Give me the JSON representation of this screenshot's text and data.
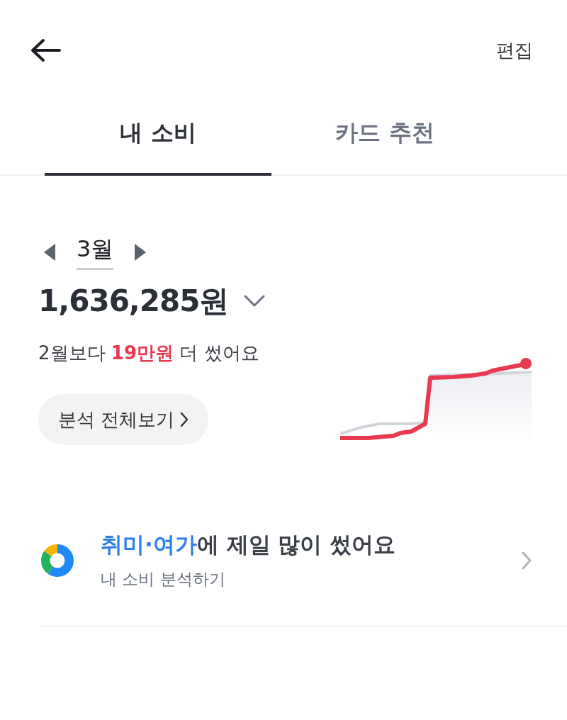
{
  "header": {
    "edit_label": "편집"
  },
  "tabs": [
    {
      "label": "내 소비",
      "selected": true
    },
    {
      "label": "카드 추천",
      "selected": false
    }
  ],
  "month": {
    "label": "3월"
  },
  "total": {
    "amount": "1,636,285원"
  },
  "comparison": "2월보다 **19만원** 더 썼어요",
  "analysis_button": {
    "label": "분석 전체보기"
  },
  "insight": {
    "title": "**취미·여가**에 제일 많이 썼어요",
    "subtitle": "내 소비 분석하기"
  }
}
